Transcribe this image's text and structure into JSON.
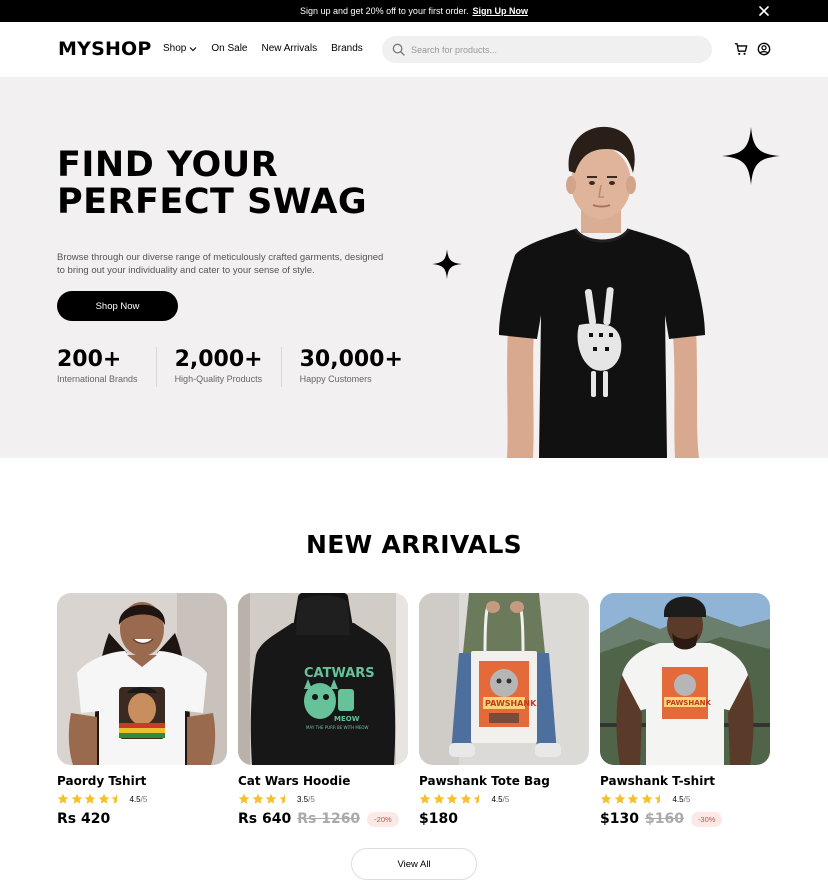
{
  "announcement": {
    "message": "Sign up and get 20% off to your first order.",
    "link": "Sign Up Now"
  },
  "header": {
    "logo": "MYSHOP",
    "nav": [
      {
        "label": "Shop",
        "has_dropdown": true
      },
      {
        "label": "On Sale"
      },
      {
        "label": "New Arrivals"
      },
      {
        "label": "Brands"
      }
    ],
    "search_placeholder": "Search for products..."
  },
  "hero": {
    "title_line1": "FIND YOUR",
    "title_line2": "PERFECT SWAG",
    "description": "Browse through our diverse range of meticulously crafted garments, designed to bring out your individuality and cater to your sense of style.",
    "cta": "Shop Now",
    "stats": [
      {
        "value": "200+",
        "label": "International Brands"
      },
      {
        "value": "2,000+",
        "label": "High-Quality Products"
      },
      {
        "value": "30,000+",
        "label": "Happy Customers"
      }
    ]
  },
  "new_arrivals": {
    "title": "NEW ARRIVALS",
    "products": [
      {
        "name": "Paordy Tshirt",
        "rating": 4.5,
        "rating_value": "4.5",
        "rating_max": "/5",
        "price": "Rs 420",
        "old_price": "",
        "discount": ""
      },
      {
        "name": "Cat Wars Hoodie",
        "rating": 3.5,
        "rating_value": "3.5",
        "rating_max": "/5",
        "price": "Rs 640",
        "old_price": "Rs 1260",
        "discount": "-20%"
      },
      {
        "name": "Pawshank Tote Bag",
        "rating": 4.5,
        "rating_value": "4.5",
        "rating_max": "/5",
        "price": "$180",
        "old_price": "",
        "discount": ""
      },
      {
        "name": "Pawshank T-shirt",
        "rating": 4.5,
        "rating_value": "4.5",
        "rating_max": "/5",
        "price": "$130",
        "old_price": "$160",
        "discount": "-30%"
      }
    ],
    "view_all": "View All"
  },
  "colors": {
    "primary": "#000000",
    "hero_bg": "#f2f0f1",
    "star": "#f5c02c",
    "discount_bg": "#fde8e8",
    "discount_text": "#e04848"
  }
}
